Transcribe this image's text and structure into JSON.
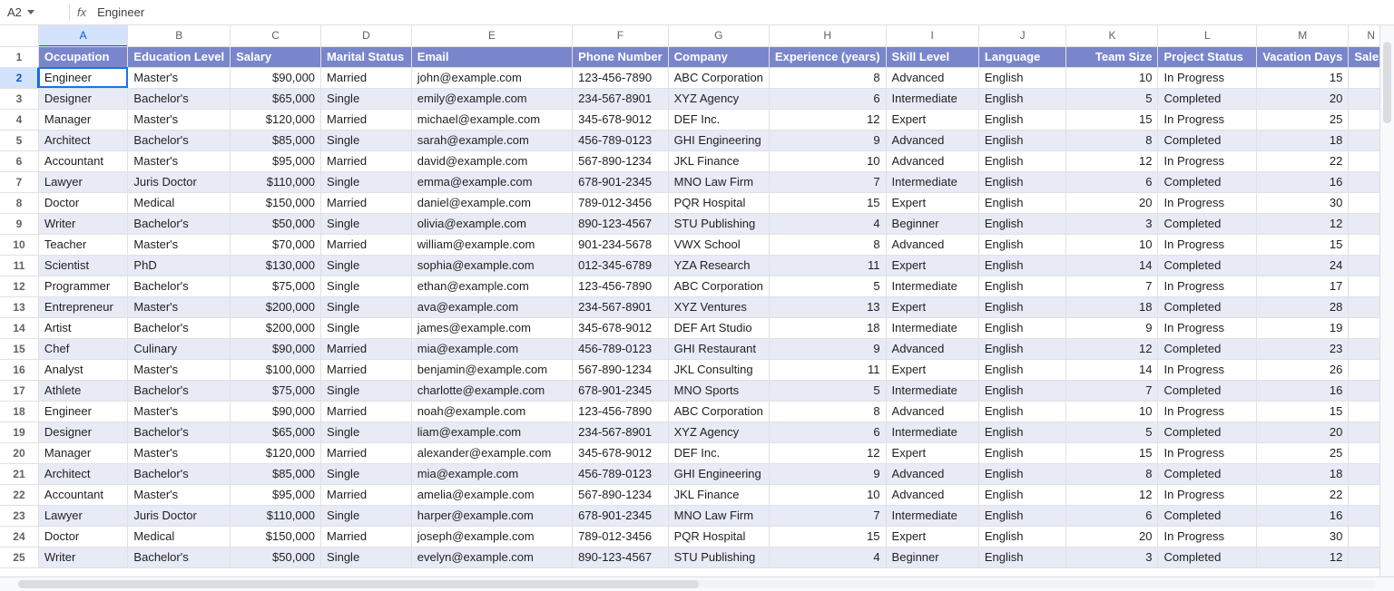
{
  "namebox": "A2",
  "formula": "Engineer",
  "fx_label": "fx",
  "column_letters": [
    "A",
    "B",
    "C",
    "D",
    "E",
    "F",
    "G",
    "H",
    "I",
    "J",
    "K",
    "L",
    "M",
    "N"
  ],
  "selected_col_index": 0,
  "selected_row_index": 1,
  "last_col_header_partial": "Sales",
  "headers": [
    "Occupation",
    "Education Level",
    "Salary",
    "Marital Status",
    "Email",
    "Phone Number",
    "Company",
    "Experience (years)",
    "Skill Level",
    "Language",
    "Team Size",
    "Project Status",
    "Vacation Days"
  ],
  "numeric_cols": [
    2,
    7,
    10,
    12
  ],
  "header_numeric_cols": [
    10,
    12
  ],
  "rows": [
    [
      "Engineer",
      "Master's",
      "$90,000",
      "Married",
      "john@example.com",
      "123-456-7890",
      "ABC Corporation",
      "8",
      "Advanced",
      "English",
      "10",
      "In Progress",
      "15"
    ],
    [
      "Designer",
      "Bachelor's",
      "$65,000",
      "Single",
      "emily@example.com",
      "234-567-8901",
      "XYZ Agency",
      "6",
      "Intermediate",
      "English",
      "5",
      "Completed",
      "20"
    ],
    [
      "Manager",
      "Master's",
      "$120,000",
      "Married",
      "michael@example.com",
      "345-678-9012",
      "DEF Inc.",
      "12",
      "Expert",
      "English",
      "15",
      "In Progress",
      "25"
    ],
    [
      "Architect",
      "Bachelor's",
      "$85,000",
      "Single",
      "sarah@example.com",
      "456-789-0123",
      "GHI Engineering",
      "9",
      "Advanced",
      "English",
      "8",
      "Completed",
      "18"
    ],
    [
      "Accountant",
      "Master's",
      "$95,000",
      "Married",
      "david@example.com",
      "567-890-1234",
      "JKL Finance",
      "10",
      "Advanced",
      "English",
      "12",
      "In Progress",
      "22"
    ],
    [
      "Lawyer",
      "Juris Doctor",
      "$110,000",
      "Single",
      "emma@example.com",
      "678-901-2345",
      "MNO Law Firm",
      "7",
      "Intermediate",
      "English",
      "6",
      "Completed",
      "16"
    ],
    [
      "Doctor",
      "Medical",
      "$150,000",
      "Married",
      "daniel@example.com",
      "789-012-3456",
      "PQR Hospital",
      "15",
      "Expert",
      "English",
      "20",
      "In Progress",
      "30"
    ],
    [
      "Writer",
      "Bachelor's",
      "$50,000",
      "Single",
      "olivia@example.com",
      "890-123-4567",
      "STU Publishing",
      "4",
      "Beginner",
      "English",
      "3",
      "Completed",
      "12"
    ],
    [
      "Teacher",
      "Master's",
      "$70,000",
      "Married",
      "william@example.com",
      "901-234-5678",
      "VWX School",
      "8",
      "Advanced",
      "English",
      "10",
      "In Progress",
      "15"
    ],
    [
      "Scientist",
      "PhD",
      "$130,000",
      "Single",
      "sophia@example.com",
      "012-345-6789",
      "YZA Research",
      "11",
      "Expert",
      "English",
      "14",
      "Completed",
      "24"
    ],
    [
      "Programmer",
      "Bachelor's",
      "$75,000",
      "Single",
      "ethan@example.com",
      "123-456-7890",
      "ABC Corporation",
      "5",
      "Intermediate",
      "English",
      "7",
      "In Progress",
      "17"
    ],
    [
      "Entrepreneur",
      "Master's",
      "$200,000",
      "Single",
      "ava@example.com",
      "234-567-8901",
      "XYZ Ventures",
      "13",
      "Expert",
      "English",
      "18",
      "Completed",
      "28"
    ],
    [
      "Artist",
      "Bachelor's",
      "$200,000",
      "Single",
      "james@example.com",
      "345-678-9012",
      "DEF Art Studio",
      "18",
      "Intermediate",
      "English",
      "9",
      "In Progress",
      "19"
    ],
    [
      "Chef",
      "Culinary",
      "$90,000",
      "Married",
      "mia@example.com",
      "456-789-0123",
      "GHI Restaurant",
      "9",
      "Advanced",
      "English",
      "12",
      "Completed",
      "23"
    ],
    [
      "Analyst",
      "Master's",
      "$100,000",
      "Married",
      "benjamin@example.com",
      "567-890-1234",
      "JKL Consulting",
      "11",
      "Expert",
      "English",
      "14",
      "In Progress",
      "26"
    ],
    [
      "Athlete",
      "Bachelor's",
      "$75,000",
      "Single",
      "charlotte@example.com",
      "678-901-2345",
      "MNO Sports",
      "5",
      "Intermediate",
      "English",
      "7",
      "Completed",
      "16"
    ],
    [
      "Engineer",
      "Master's",
      "$90,000",
      "Married",
      "noah@example.com",
      "123-456-7890",
      "ABC Corporation",
      "8",
      "Advanced",
      "English",
      "10",
      "In Progress",
      "15"
    ],
    [
      "Designer",
      "Bachelor's",
      "$65,000",
      "Single",
      "liam@example.com",
      "234-567-8901",
      "XYZ Agency",
      "6",
      "Intermediate",
      "English",
      "5",
      "Completed",
      "20"
    ],
    [
      "Manager",
      "Master's",
      "$120,000",
      "Married",
      "alexander@example.com",
      "345-678-9012",
      "DEF Inc.",
      "12",
      "Expert",
      "English",
      "15",
      "In Progress",
      "25"
    ],
    [
      "Architect",
      "Bachelor's",
      "$85,000",
      "Single",
      "mia@example.com",
      "456-789-0123",
      "GHI Engineering",
      "9",
      "Advanced",
      "English",
      "8",
      "Completed",
      "18"
    ],
    [
      "Accountant",
      "Master's",
      "$95,000",
      "Married",
      "amelia@example.com",
      "567-890-1234",
      "JKL Finance",
      "10",
      "Advanced",
      "English",
      "12",
      "In Progress",
      "22"
    ],
    [
      "Lawyer",
      "Juris Doctor",
      "$110,000",
      "Single",
      "harper@example.com",
      "678-901-2345",
      "MNO Law Firm",
      "7",
      "Intermediate",
      "English",
      "6",
      "Completed",
      "16"
    ],
    [
      "Doctor",
      "Medical",
      "$150,000",
      "Married",
      "joseph@example.com",
      "789-012-3456",
      "PQR Hospital",
      "15",
      "Expert",
      "English",
      "20",
      "In Progress",
      "30"
    ],
    [
      "Writer",
      "Bachelor's",
      "$50,000",
      "Single",
      "evelyn@example.com",
      "890-123-4567",
      "STU Publishing",
      "4",
      "Beginner",
      "English",
      "3",
      "Completed",
      "12"
    ]
  ]
}
